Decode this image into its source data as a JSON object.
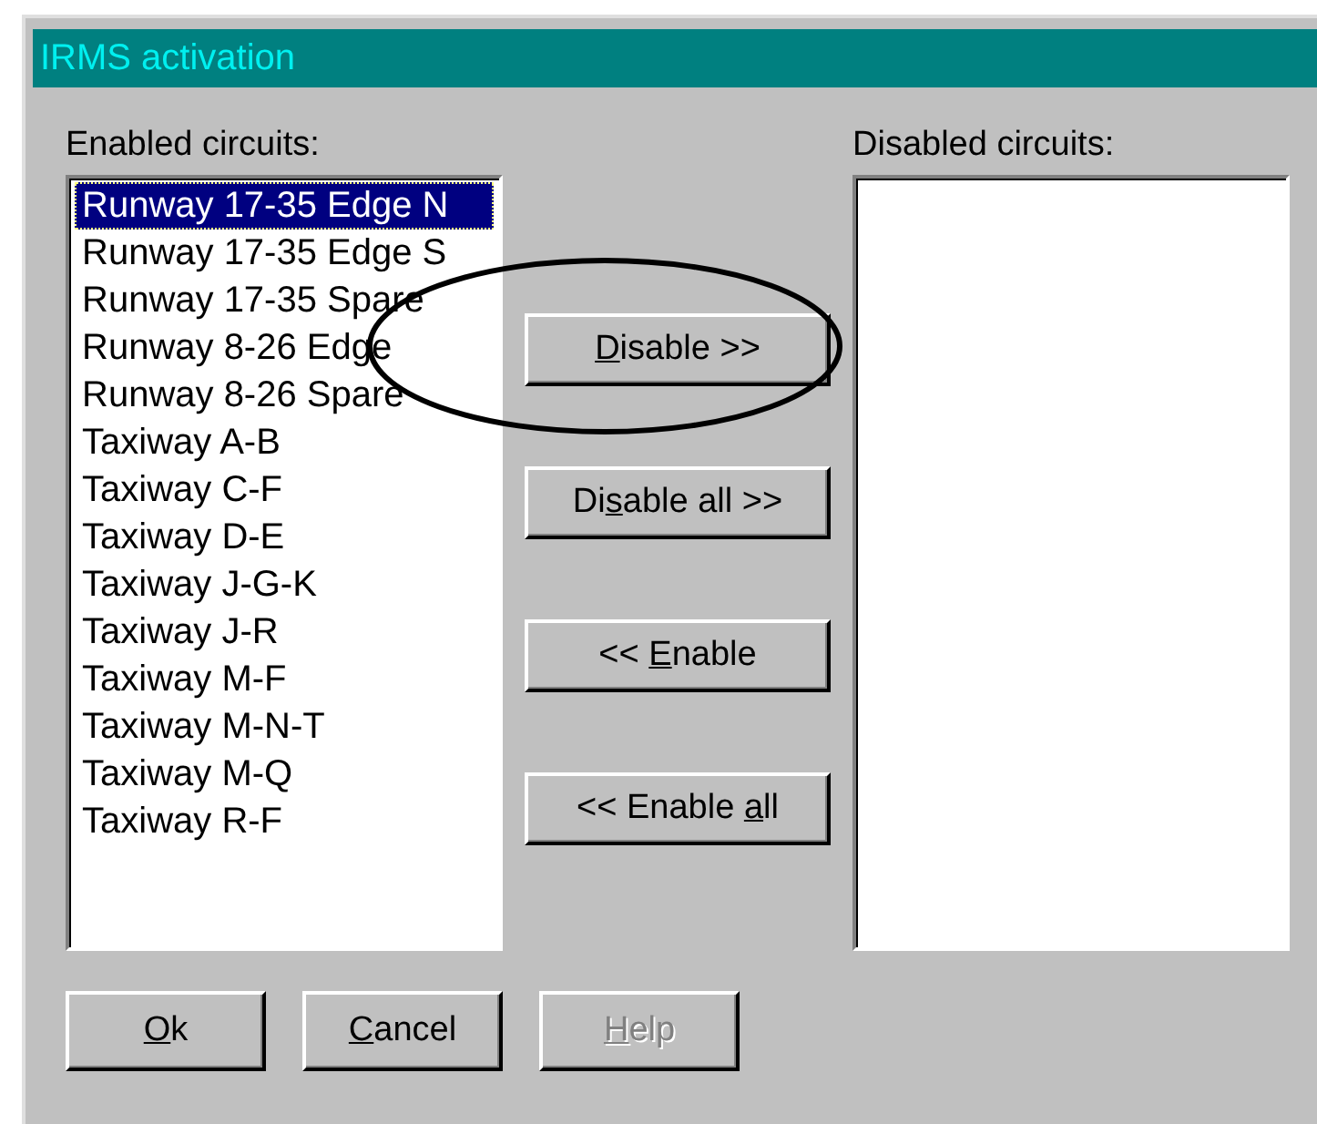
{
  "window": {
    "title": "IRMS activation"
  },
  "enabled_list": {
    "label": "Enabled circuits:",
    "items": [
      {
        "text": "Runway 17-35 Edge N",
        "selected": true
      },
      {
        "text": "Runway 17-35 Edge S",
        "selected": false
      },
      {
        "text": "Runway 17-35 Spare",
        "selected": false
      },
      {
        "text": "Runway 8-26 Edge",
        "selected": false
      },
      {
        "text": "Runway 8-26 Spare",
        "selected": false
      },
      {
        "text": "Taxiway A-B",
        "selected": false
      },
      {
        "text": "Taxiway C-F",
        "selected": false
      },
      {
        "text": "Taxiway D-E",
        "selected": false
      },
      {
        "text": "Taxiway J-G-K",
        "selected": false
      },
      {
        "text": "Taxiway J-R",
        "selected": false
      },
      {
        "text": "Taxiway M-F",
        "selected": false
      },
      {
        "text": "Taxiway M-N-T",
        "selected": false
      },
      {
        "text": "Taxiway M-Q",
        "selected": false
      },
      {
        "text": "Taxiway R-F",
        "selected": false
      }
    ]
  },
  "disabled_list": {
    "label": "Disabled circuits:"
  },
  "move_buttons": [
    {
      "key": "D",
      "after": "isable >>",
      "disabled": false
    },
    {
      "before": "Di",
      "key": "s",
      "after": "able all >>",
      "disabled": false
    },
    {
      "before": "<< ",
      "key": "E",
      "after": "nable",
      "disabled": false
    },
    {
      "before": "<< Enable ",
      "key": "a",
      "after": "ll",
      "disabled": false
    }
  ],
  "dialog_buttons": [
    {
      "key": "O",
      "after": "k",
      "disabled": false
    },
    {
      "key": "C",
      "after": "ancel",
      "disabled": false
    },
    {
      "key": "H",
      "after": "elp",
      "disabled": true
    }
  ],
  "annotation": {
    "kind": "ellipse"
  }
}
